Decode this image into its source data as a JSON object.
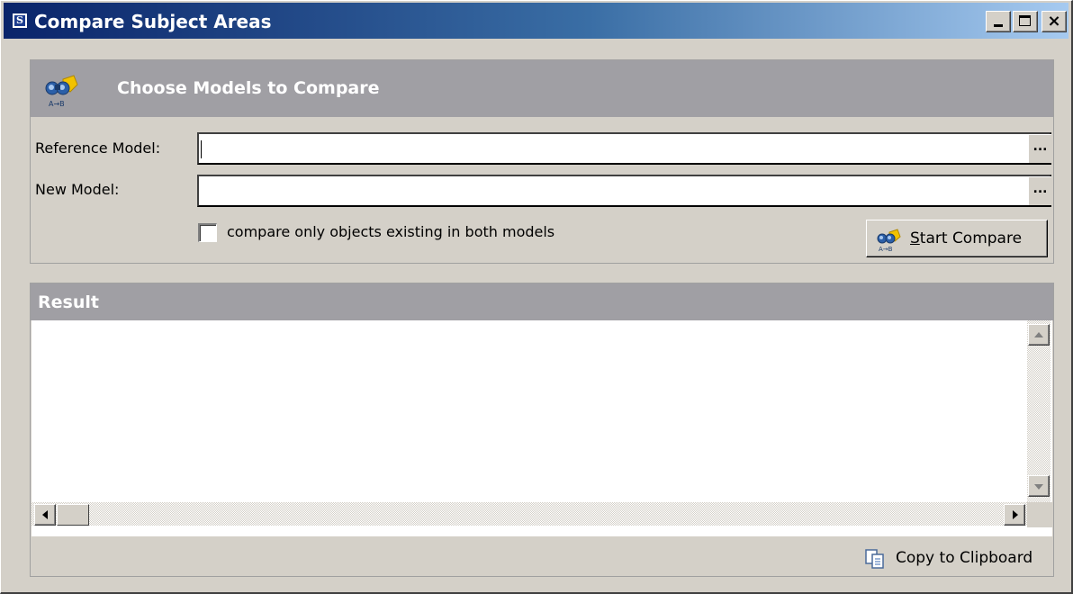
{
  "window": {
    "title": "Compare Subject Areas",
    "app_icon_letter": "S",
    "controls": {
      "minimize": "_",
      "maximize": "□",
      "close": "×"
    }
  },
  "choose_panel": {
    "header": "Choose Models to Compare",
    "icon": "binoculars-compare-icon",
    "icon_caption": "A→B",
    "reference_label": "Reference Model:",
    "reference_value": "",
    "new_label": "New Model:",
    "new_value": "",
    "browse_label": "...",
    "checkbox_label": "compare only objects existing in both models",
    "checkbox_checked": false,
    "start_button_label": "Start Compare"
  },
  "result_panel": {
    "header": "Result",
    "content": "",
    "copy_button_label": "Copy to Clipboard",
    "copy_icon": "copy-clipboard-icon"
  },
  "colors": {
    "titlebar_start": "#0a246a",
    "titlebar_end": "#a6caf0",
    "panel_header": "#a09fa4",
    "window_bg": "#d4d0c8"
  }
}
